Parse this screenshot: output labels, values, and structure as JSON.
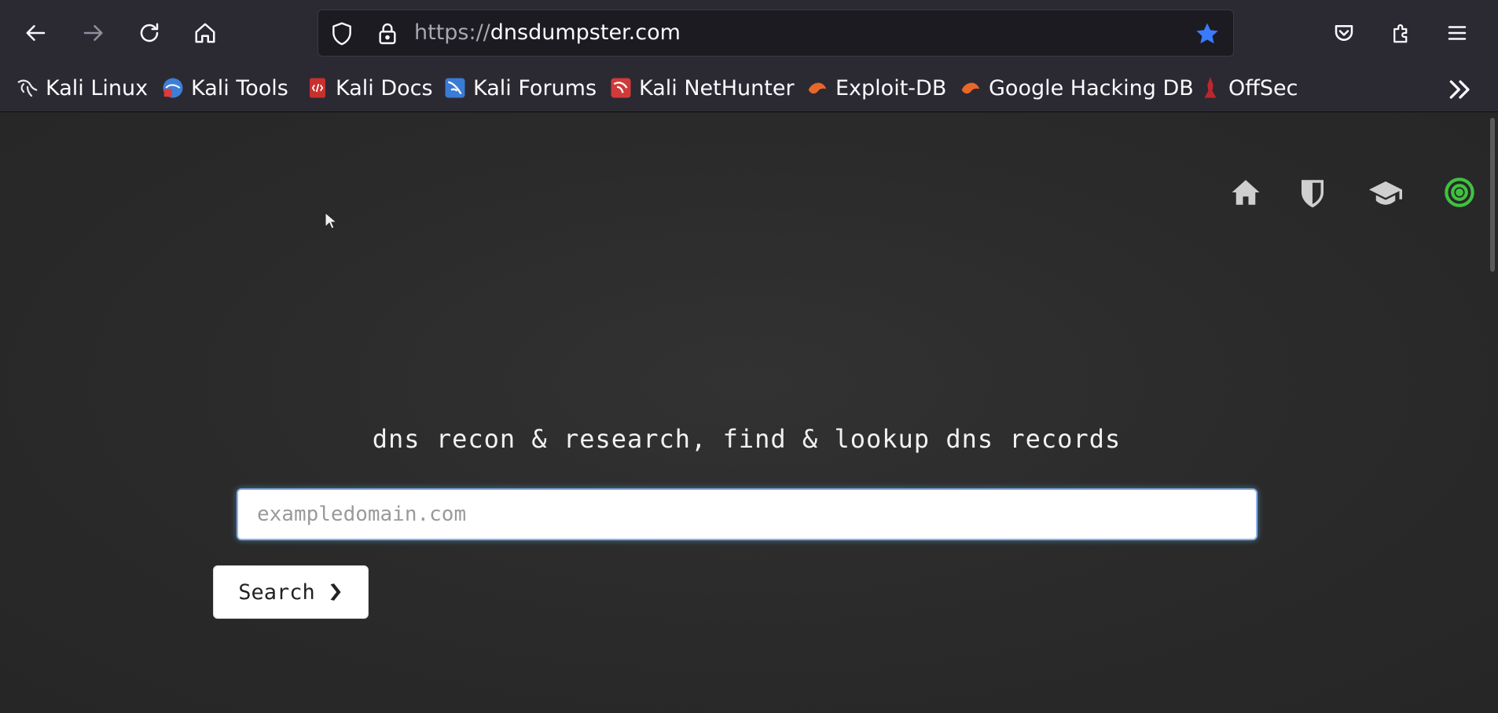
{
  "browser": {
    "url_scheme": "https://",
    "url_host": "dnsdumpster.com",
    "accent": "#3a7bfd"
  },
  "bookmarks": [
    {
      "label": "Kali Linux",
      "icon": "kali-dragon-icon"
    },
    {
      "label": "Kali Tools",
      "icon": "kali-tools-icon"
    },
    {
      "label": "Kali Docs",
      "icon": "kali-docs-icon"
    },
    {
      "label": "Kali Forums",
      "icon": "kali-forums-icon"
    },
    {
      "label": "Kali NetHunter",
      "icon": "kali-nethunter-icon"
    },
    {
      "label": "Exploit-DB",
      "icon": "exploit-db-icon"
    },
    {
      "label": "Google Hacking DB",
      "icon": "ghdb-icon"
    },
    {
      "label": "OffSec",
      "icon": "offsec-icon"
    }
  ],
  "site": {
    "nav_icons": [
      "home-icon",
      "shield-icon",
      "graduation-cap-icon",
      "target-icon"
    ],
    "target_color": "#3fc23f",
    "tagline": "dns recon & research, find & lookup dns records",
    "search_placeholder": "exampledomain.com",
    "search_button_label": "Search"
  }
}
